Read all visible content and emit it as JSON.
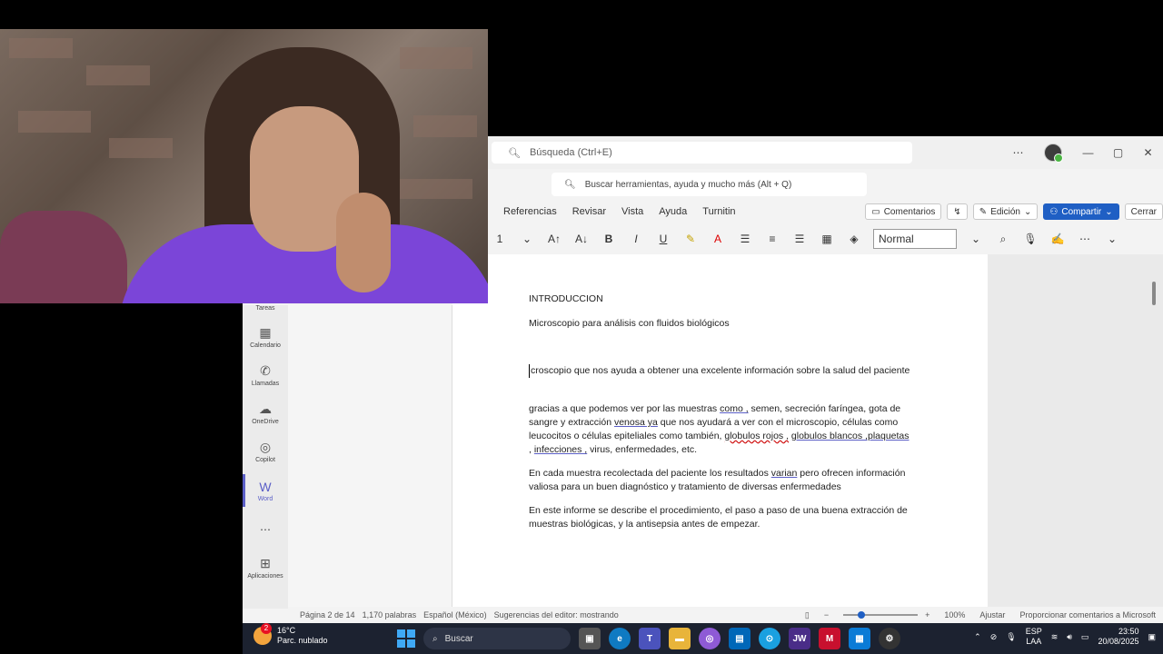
{
  "titlebar": {
    "search_placeholder": "Búsqueda (Ctrl+E)",
    "more": "⋯",
    "minimize": "—",
    "maximize": "▢",
    "close": "✕"
  },
  "word": {
    "search_placeholder": "Buscar herramientas, ayuda y mucho más (Alt + Q)"
  },
  "menu": {
    "items": [
      "Referencias",
      "Revisar",
      "Vista",
      "Ayuda",
      "Turnitin"
    ],
    "comments": "Comentarios",
    "editing": "Edición",
    "share": "Compartir",
    "close": "Cerrar"
  },
  "ribbon": {
    "font_size": "1",
    "style": "Normal"
  },
  "sidebar": {
    "items": [
      {
        "label": "Tareas",
        "icon": "tasks-icon"
      },
      {
        "label": "Calendario",
        "icon": "calendar-icon"
      },
      {
        "label": "Llamadas",
        "icon": "phone-icon"
      },
      {
        "label": "OneDrive",
        "icon": "cloud-icon"
      },
      {
        "label": "Copilot",
        "icon": "copilot-icon"
      },
      {
        "label": "Word",
        "icon": "word-icon"
      },
      {
        "label": "⋯",
        "icon": "more-icon"
      },
      {
        "label": "Aplicaciones",
        "icon": "add-app-icon"
      }
    ]
  },
  "doc": {
    "title": "INTRODUCCION",
    "subtitle": "Microscopio para análisis con fluidos biológicos",
    "p1": "croscopio que nos ayuda a obtener una excelente información sobre la salud del paciente",
    "p2_a": "gracias a que podemos ver por las muestras ",
    "p2_como": "como ,",
    "p2_b": " semen, secreción faríngea, gota de sangre y extracción ",
    "p2_venosa": "venosa  ya",
    "p2_c": " que nos ayudará a ver con el microscopio, células como leucocitos o células epiteliales como también, ",
    "p2_globulos1": "globulos rojos ,",
    "p2_d": " ",
    "p2_globulos2": "globulos blancos ,plaquetas",
    "p2_e": " , ",
    "p2_infecciones": "infecciones ,",
    "p2_f": " virus, enfermedades, etc.",
    "p3_a": "En cada muestra recolectada del paciente los resultados ",
    "p3_varian": "varian",
    "p3_b": " pero ofrecen información valiosa para un buen diagnóstico y tratamiento de diversas enfermedades",
    "p4": "En este informe se describe el procedimiento, el paso a paso de una buena extracción de muestras biológicas, y la antisepsia antes de empezar."
  },
  "status": {
    "page": "Página 2 de 14",
    "words": "1,170 palabras",
    "lang": "Español (México)",
    "suggestions": "Sugerencias del editor: mostrando",
    "zoom": "100%",
    "fit": "Ajustar",
    "feedback": "Proporcionar comentarios a Microsoft"
  },
  "taskbar": {
    "temp": "16°C",
    "weather": "Parc. nublado",
    "badge": "2",
    "search": "Buscar",
    "lang1": "ESP",
    "lang2": "LAA",
    "time": "23:50",
    "date": "20/08/2025"
  },
  "colors": {
    "accent": "#1f5fc4",
    "purple": "#5b5fc7",
    "taskbar": "#1c2230"
  }
}
